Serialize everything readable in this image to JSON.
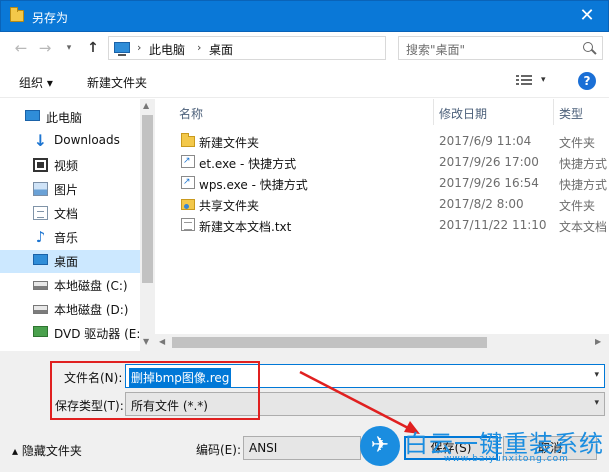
{
  "window": {
    "title": "另存为",
    "close_glyph": "✕"
  },
  "address": {
    "crumbs": [
      "此电脑",
      "桌面"
    ],
    "search_placeholder": "搜索\"桌面\""
  },
  "toolbar": {
    "organize": "组织 ▾",
    "new_folder": "新建文件夹"
  },
  "nav": {
    "items": [
      {
        "label": "此电脑",
        "icon": "computer-icon"
      },
      {
        "label": "Downloads",
        "icon": "download-arrow-icon"
      },
      {
        "label": "视频",
        "icon": "video-icon"
      },
      {
        "label": "图片",
        "icon": "picture-icon"
      },
      {
        "label": "文档",
        "icon": "document-icon"
      },
      {
        "label": "音乐",
        "icon": "music-note-icon"
      },
      {
        "label": "桌面",
        "icon": "desktop-icon",
        "selected": true
      },
      {
        "label": "本地磁盘 (C:)",
        "icon": "drive-icon"
      },
      {
        "label": "本地磁盘 (D:)",
        "icon": "drive-icon"
      },
      {
        "label": "DVD 驱动器 (E:)",
        "icon": "dvd-drive-icon"
      }
    ]
  },
  "columns": {
    "name": "名称",
    "date": "修改日期",
    "type": "类型"
  },
  "files": [
    {
      "name": "新建文件夹",
      "date": "2017/6/9 11:04",
      "type": "文件夹",
      "icon": "folder-icon"
    },
    {
      "name": "et.exe - 快捷方式",
      "date": "2017/9/26 17:00",
      "type": "快捷方式",
      "icon": "shortcut-icon"
    },
    {
      "name": "wps.exe - 快捷方式",
      "date": "2017/9/26 16:54",
      "type": "快捷方式",
      "icon": "shortcut-icon"
    },
    {
      "name": "共享文件夹",
      "date": "2017/8/2 8:00",
      "type": "文件夹",
      "icon": "shared-folder-icon"
    },
    {
      "name": "新建文本文档.txt",
      "date": "2017/11/22 11:10",
      "type": "文本文档",
      "icon": "text-file-icon"
    }
  ],
  "form": {
    "filename_label": "文件名(N):",
    "filename_value": "删掉bmp图像.reg",
    "filetype_label": "保存类型(T):",
    "filetype_value": "所有文件 (*.*)",
    "hide_folders": "隐藏文件夹",
    "encoding_label": "编码(E):",
    "encoding_value": "ANSI",
    "save": "保存(S)",
    "cancel": "取消"
  },
  "watermark": {
    "text": "白云一键重装系统",
    "url": "www.baiyunxitong.com"
  },
  "colors": {
    "title_bar": "#0a78d7",
    "selection": "#cce8ff",
    "highlight_box": "#e02020",
    "accent": "#0078d7"
  }
}
